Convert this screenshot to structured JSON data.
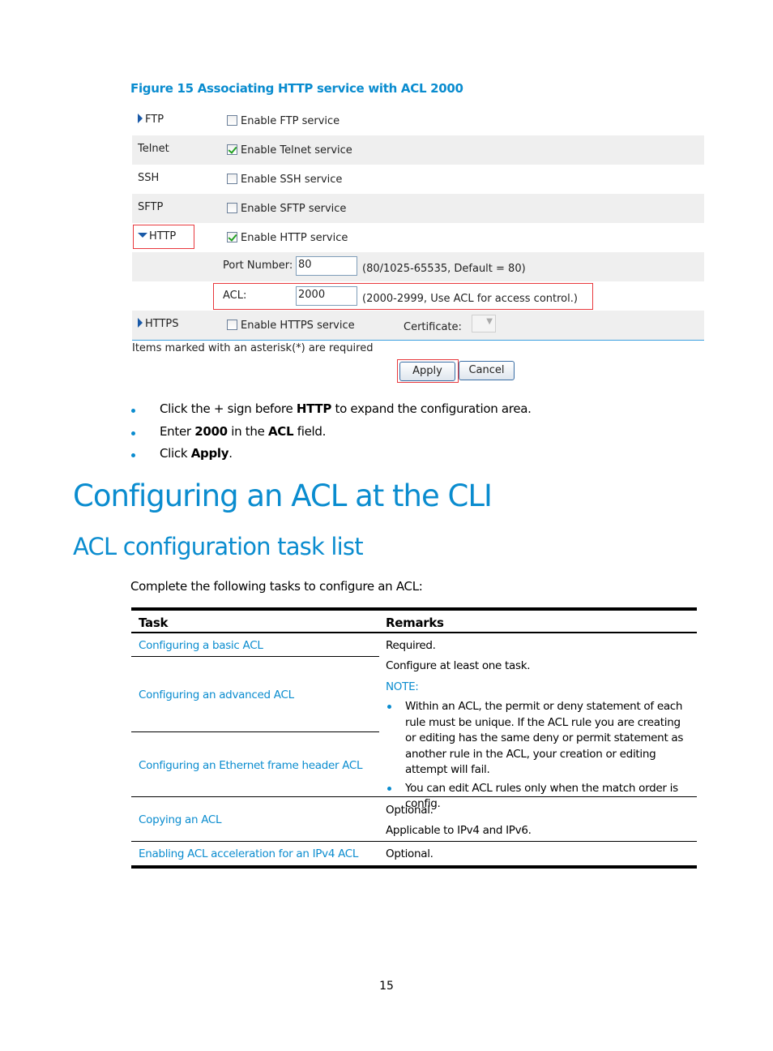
{
  "figure": {
    "caption": "Figure 15 Associating HTTP service with ACL 2000",
    "rows": [
      {
        "name": "FTP",
        "expander": "collapsed",
        "checkbox_label": "Enable FTP service",
        "checked": false
      },
      {
        "name": "Telnet",
        "expander": "none",
        "checkbox_label": "Enable Telnet service",
        "checked": true
      },
      {
        "name": "SSH",
        "expander": "none",
        "checkbox_label": "Enable SSH service",
        "checked": false
      },
      {
        "name": "SFTP",
        "expander": "none",
        "checkbox_label": "Enable SFTP service",
        "checked": false
      },
      {
        "name": "HTTP",
        "expander": "expanded",
        "checkbox_label": "Enable HTTP service",
        "checked": true
      },
      {
        "name": "HTTPS",
        "expander": "collapsed",
        "checkbox_label": "Enable HTTPS service",
        "checked": false
      }
    ],
    "port": {
      "label": "Port Number:",
      "value": "80",
      "hint": "(80/1025-65535, Default = 80)"
    },
    "acl": {
      "label": "ACL:",
      "value": "2000",
      "hint": "(2000-2999, Use ACL for access control.)"
    },
    "certificate_label": "Certificate:",
    "required_note": "Items marked with an asterisk(*) are required",
    "apply_label": "Apply",
    "cancel_label": "Cancel",
    "highlight_color": "#e8383d"
  },
  "steps": [
    {
      "pre": "Click the + sign before ",
      "bold": "HTTP",
      "mid": " to expand the configuration area.",
      "bold2": "",
      "post": ""
    },
    {
      "pre": "Enter ",
      "bold": "2000",
      "mid": " in the ",
      "bold2": "ACL",
      "post": " field."
    },
    {
      "pre": "Click ",
      "bold": "Apply",
      "mid": ".",
      "bold2": "",
      "post": ""
    }
  ],
  "heading1": "Configuring an ACL at the CLI",
  "heading2": "ACL configuration task list",
  "intro": "Complete the following tasks to configure an ACL:",
  "table": {
    "headers": [
      "Task",
      "Remarks"
    ],
    "tasks": [
      "Configuring a basic ACL",
      "Configuring an advanced ACL",
      "Configuring an Ethernet frame header ACL",
      "Copying an ACL",
      "Enabling ACL acceleration for an IPv4 ACL"
    ],
    "remarks": {
      "basic": "Required.",
      "group_line": "Configure at least one task.",
      "note_label": "NOTE:",
      "note_items": [
        "Within an ACL, the permit or deny statement of each rule must be unique. If the ACL rule you are creating or editing has the same deny or permit statement as another rule in the ACL, your creation or editing attempt will fail.",
        "You can edit ACL rules only when the match order is config."
      ],
      "copy_1": "Optional.",
      "copy_2": "Applicable to IPv4 and IPv6.",
      "accel": "Optional."
    }
  },
  "page_number": "15",
  "accent_color": "#0a8ccf"
}
